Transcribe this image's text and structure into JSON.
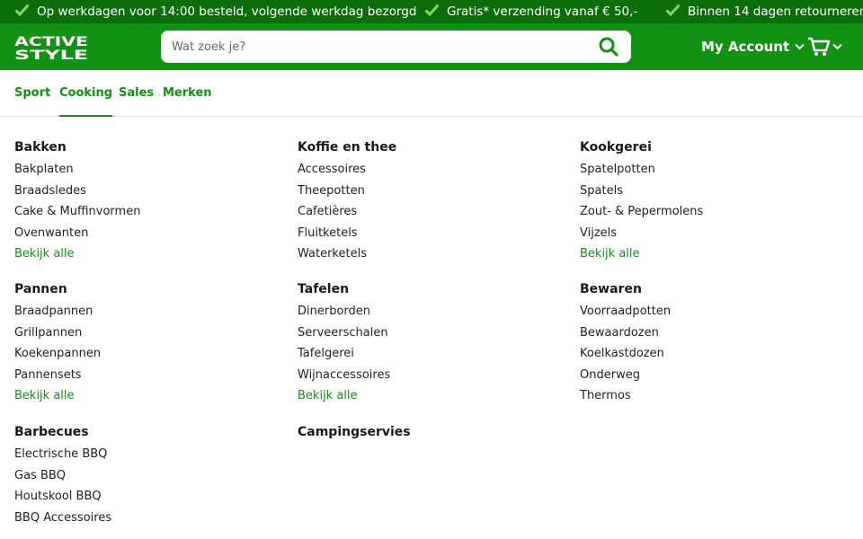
{
  "usp": [
    "Op werkdagen voor 14:00 besteld, volgende werkdag bezorgd",
    "Gratis* verzending vanaf € 50,-",
    "Binnen 14 dagen retourneren"
  ],
  "header": {
    "logo_line1": "ACTIVE",
    "logo_line2": "STYLE",
    "search_placeholder": "Wat zoek je?",
    "account_label": "My Account"
  },
  "nav": [
    "Sport",
    "Cooking",
    "Sales",
    "Merken"
  ],
  "nav_active": "Cooking",
  "colors": {
    "brand_green": "#129212",
    "dark_green": "#0b6e0b"
  },
  "menu": {
    "columns": [
      [
        {
          "title": "Bakken",
          "items": [
            "Bakplaten",
            "Braadsledes",
            "Cake & Muffinvormen",
            "Ovenwanten"
          ],
          "more": "Bekijk alle"
        },
        {
          "title": "Pannen",
          "items": [
            "Braadpannen",
            "Grillpannen",
            "Koekenpannen",
            "Pannensets"
          ],
          "more": "Bekijk alle"
        },
        {
          "title": "Barbecues",
          "items": [
            "Electrische BBQ",
            "Gas BBQ",
            "Houtskool BBQ",
            "BBQ Accessoires"
          ]
        }
      ],
      [
        {
          "title": "Koffie en thee",
          "items": [
            "Accessoires",
            "Theepotten",
            "Cafetières",
            "Fluitketels",
            "Waterketels"
          ]
        },
        {
          "title": "Tafelen",
          "items": [
            "Dinerborden",
            "Serveerschalen",
            "Tafelgerei",
            "Wijnaccessoires"
          ],
          "more": "Bekijk alle"
        },
        {
          "title": "Campingservies",
          "items": []
        }
      ],
      [
        {
          "title": "Kookgerei",
          "items": [
            "Spatelpotten",
            "Spatels",
            "Zout- & Pepermolens",
            "Vijzels"
          ],
          "more": "Bekijk alle"
        },
        {
          "title": "Bewaren",
          "items": [
            "Voorraadpotten",
            "Bewaardozen",
            "Koelkastdozen",
            "Onderweg",
            "Thermos"
          ]
        }
      ]
    ]
  }
}
